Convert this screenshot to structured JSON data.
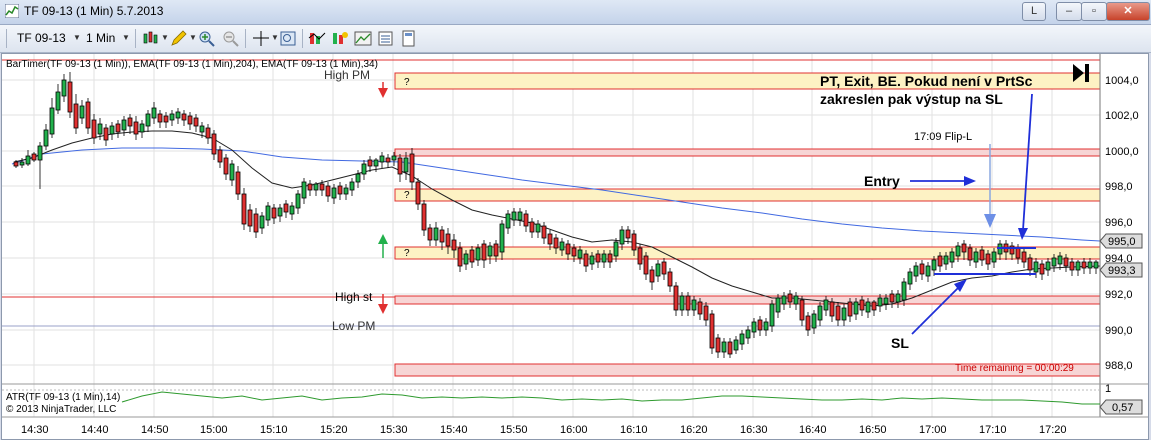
{
  "window": {
    "title": "TF 09-13 (1 Min)  5.7.2013",
    "link_button": "L",
    "minimize": "–",
    "maximize": "▫",
    "close": "✕"
  },
  "toolbar": {
    "instrument": "TF 09-13",
    "interval": "1 Min"
  },
  "chart": {
    "indicator_header": "BarTimer(TF 09-13 (1 Min)), EMA(TF 09-13 (1 Min),204), EMA(TF 09-13 (1 Min),34)",
    "atr_header": "ATR(TF 09-13 (1 Min),14)",
    "copyright": "© 2013 NinjaTrader, LLC",
    "annotation_main": "PT, Exit, BE. Pokud není v PrtSc\nzakreslen pak výstup na SL",
    "annotation_flip": "17:09 Flip-L",
    "annotation_entry": "Entry",
    "annotation_sl": "SL",
    "label_high_pm": "High PM",
    "label_high_st": "High st",
    "label_low_pm": "Low PM",
    "time_remaining": "Time remaining = 00:00:29",
    "zone_marker": "?",
    "price_labels": [
      "1004,0",
      "1002,0",
      "1000,0",
      "998,0",
      "996,0",
      "994,0",
      "992,0",
      "990,0",
      "988,0"
    ],
    "price_tag_ema": "995,0",
    "price_tag_last": "993,3",
    "atr_scale": "1",
    "atr_value": "0,57",
    "time_labels": [
      "14:30",
      "14:40",
      "14:50",
      "15:00",
      "15:10",
      "15:20",
      "15:30",
      "15:40",
      "15:50",
      "16:00",
      "16:10",
      "16:20",
      "16:30",
      "16:40",
      "16:50",
      "17:00",
      "17:10",
      "17:20"
    ],
    "colors": {
      "up_candle": "#22b14c",
      "down_candle": "#e03030",
      "ema_slow": "#4169e1",
      "ema_fast": "#222222",
      "zone_fill_red": "#f7d5d5",
      "zone_fill_yellow": "#fdf2c4",
      "zone_border": "#e03030",
      "atr_line": "#2e9a2e",
      "annotation_blue": "#1f2fd8"
    }
  }
}
